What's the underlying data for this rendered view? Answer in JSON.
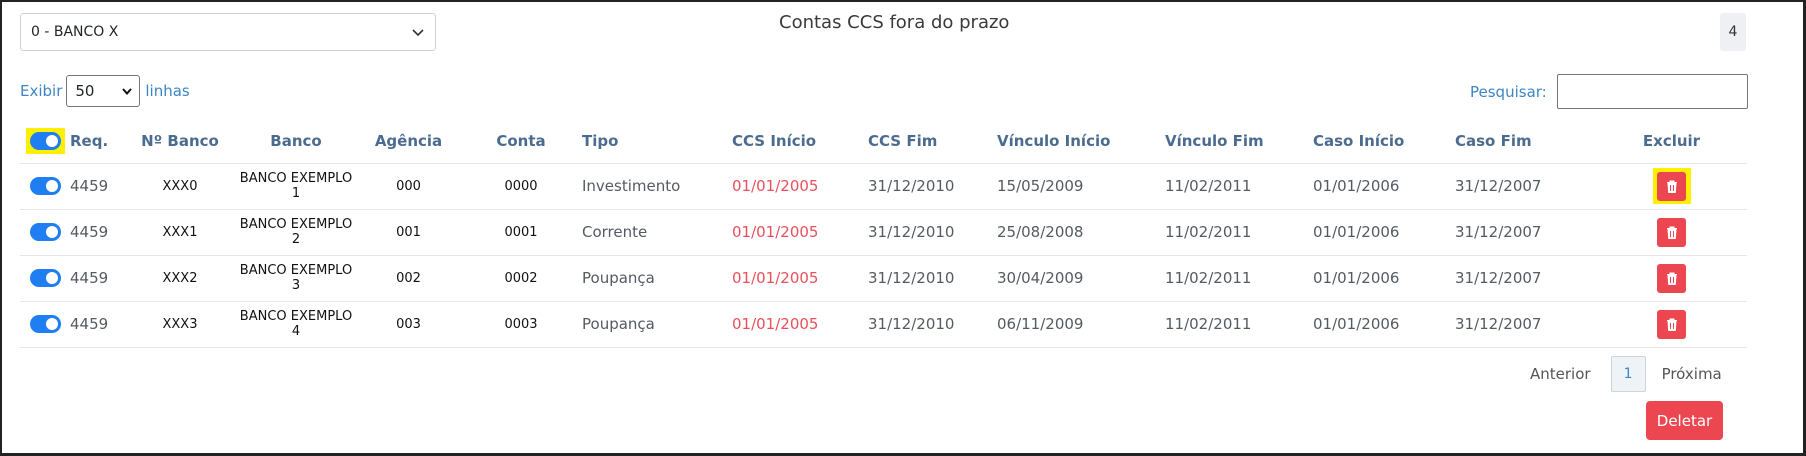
{
  "bank_select": {
    "value": "0 - BANCO X"
  },
  "title": "Contas CCS fora do prazo",
  "count_badge": "4",
  "length": {
    "prefix": "Exibir",
    "value": "50",
    "suffix": "linhas"
  },
  "search": {
    "label": "Pesquisar:",
    "value": ""
  },
  "columns": [
    "Req.",
    "Nº Banco",
    "Banco",
    "Agência",
    "Conta",
    "Tipo",
    "CCS Início",
    "CCS Fim",
    "Vínculo Início",
    "Vínculo Fim",
    "Caso Início",
    "Caso Fim",
    "Excluir"
  ],
  "rows": [
    {
      "req": "4459",
      "n_banco": "XXX0",
      "banco": "BANCO EXEMPLO 1",
      "agencia": "000",
      "conta": "0000",
      "tipo": "Investimento",
      "ccs_inicio": "01/01/2005",
      "ccs_fim": "31/12/2010",
      "vinculo_inicio": "15/05/2009",
      "vinculo_fim": "11/02/2011",
      "caso_inicio": "01/01/2006",
      "caso_fim": "31/12/2007"
    },
    {
      "req": "4459",
      "n_banco": "XXX1",
      "banco": "BANCO EXEMPLO 2",
      "agencia": "001",
      "conta": "0001",
      "tipo": "Corrente",
      "ccs_inicio": "01/01/2005",
      "ccs_fim": "31/12/2010",
      "vinculo_inicio": "25/08/2008",
      "vinculo_fim": "11/02/2011",
      "caso_inicio": "01/01/2006",
      "caso_fim": "31/12/2007"
    },
    {
      "req": "4459",
      "n_banco": "XXX2",
      "banco": "BANCO EXEMPLO 3",
      "agencia": "002",
      "conta": "0002",
      "tipo": "Poupança",
      "ccs_inicio": "01/01/2005",
      "ccs_fim": "31/12/2010",
      "vinculo_inicio": "30/04/2009",
      "vinculo_fim": "11/02/2011",
      "caso_inicio": "01/01/2006",
      "caso_fim": "31/12/2007"
    },
    {
      "req": "4459",
      "n_banco": "XXX3",
      "banco": "BANCO EXEMPLO 4",
      "agencia": "003",
      "conta": "0003",
      "tipo": "Poupança",
      "ccs_inicio": "01/01/2005",
      "ccs_fim": "31/12/2010",
      "vinculo_inicio": "06/11/2009",
      "vinculo_fim": "11/02/2011",
      "caso_inicio": "01/01/2006",
      "caso_fim": "31/12/2007"
    }
  ],
  "pagination": {
    "prev": "Anterior",
    "page": "1",
    "next": "Próxima"
  },
  "delete_button": "Deletar",
  "colors": {
    "accent_blue": "#1f7ff2",
    "danger_red": "#ec4751",
    "highlight_yellow": "#ffef00",
    "date_red": "#e8505b",
    "header_blue": "#4c6c8f"
  },
  "icons": {
    "select_arrow": "chevron-down-icon",
    "delete": "trash-icon"
  }
}
